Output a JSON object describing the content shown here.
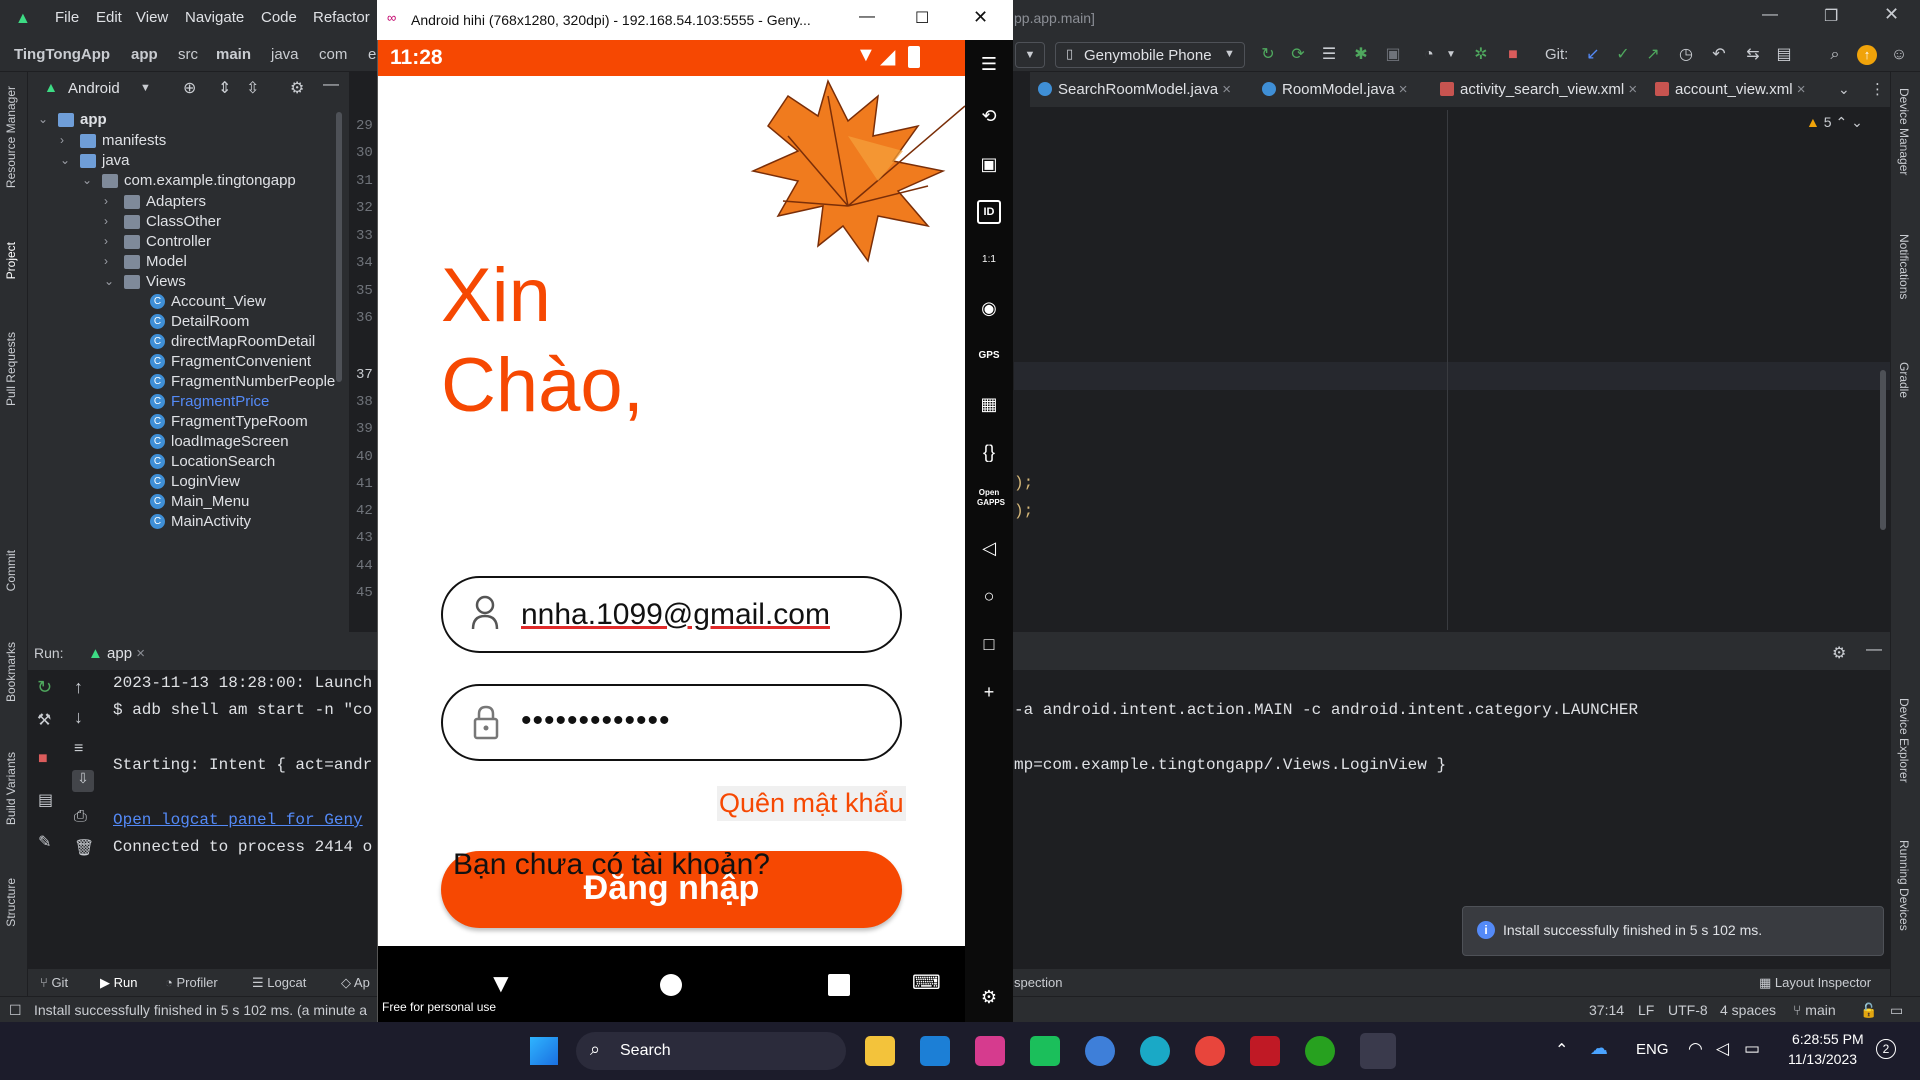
{
  "ide": {
    "menu": [
      "File",
      "Edit",
      "View",
      "Navigate",
      "Code",
      "Refactor"
    ],
    "breadcrumbs": [
      "TingTongApp",
      "app",
      "src",
      "main",
      "java",
      "com",
      "e"
    ],
    "device_selector": "Genymobile Phone",
    "git_label": "Git:",
    "title_fragment": "pp.app.main]",
    "android_view_label": "Android",
    "tree": {
      "app": "app",
      "manifests": "manifests",
      "java": "java",
      "package": "com.example.tingtongapp",
      "folders": [
        "Adapters",
        "ClassOther",
        "Controller",
        "Model",
        "Views"
      ],
      "classes": [
        "Account_View",
        "DetailRoom",
        "directMapRoomDetail",
        "FragmentConvenient",
        "FragmentNumberPeople",
        "FragmentPrice",
        "FragmentTypeRoom",
        "loadImageScreen",
        "LocationSearch",
        "LoginView",
        "Main_Menu",
        "MainActivity"
      ],
      "highlighted_class": "FragmentPrice"
    },
    "line_numbers": [
      "29",
      "30",
      "31",
      "32",
      "33",
      "34",
      "35",
      "36",
      "37",
      "38",
      "39",
      "40",
      "41",
      "42",
      "43",
      "44",
      "45"
    ],
    "editor_tabs": [
      "SearchRoomModel.java",
      "RoomModel.java",
      "activity_search_view.xml",
      "account_view.xml"
    ],
    "warning_count": "5",
    "code_fragments": [
      ");",
      ");"
    ],
    "run": {
      "label": "Run:",
      "config": "app",
      "lines_left": [
        "2023-11-13 18:28:00: Launch",
        "$ adb shell am start -n \"co",
        "",
        "Starting: Intent { act=andr",
        "",
        "Open logcat panel for Geny",
        "Connected to process 2414 o"
      ],
      "lines_right": [
        "-a android.intent.action.MAIN -c android.intent.category.LAUNCHER",
        "mp=com.example.tingtongapp/.Views.LoginView }"
      ]
    },
    "bottom_tools": [
      "Git",
      "Run",
      "Profiler",
      "Logcat",
      "Ap",
      "spection",
      "Layout Inspector"
    ],
    "status": {
      "message": "Install successfully finished in 5 s 102 ms. (a minute a",
      "position": "37:14",
      "line_sep": "LF",
      "encoding": "UTF-8",
      "indent": "4 spaces",
      "branch": "main"
    },
    "notification": "Install successfully finished in 5 s 102 ms.",
    "side_labels_left": [
      "Resource Manager",
      "Project",
      "Pull Requests",
      "Commit",
      "Bookmarks",
      "Build Variants",
      "Structure"
    ],
    "side_labels_right": [
      "Device Manager",
      "Notifications",
      "Gradle",
      "Device Explorer",
      "Running Devices"
    ]
  },
  "emulator": {
    "window_title": "Android hihi (768x1280, 320dpi) - 192.168.54.103:5555 - Geny...",
    "time": "11:28",
    "greeting_line1": "Xin",
    "greeting_line2": "Chào,",
    "email_value": "nnha.1099@gmail.com",
    "password_value": "•••••••••••••",
    "forgot_password": "Quên mật khẩu",
    "login_button": "Đăng nhập",
    "no_account": "Bạn chưa có tài khoản?",
    "watermark": "Free for personal use",
    "accent_color": "#f64802",
    "side_labels": [
      "GPS",
      "Open GAPPS",
      "ID",
      "1:1"
    ]
  },
  "taskbar": {
    "search_placeholder": "Search",
    "language": "ENG",
    "time": "6:28:55 PM",
    "date": "11/13/2023",
    "badge": "2"
  }
}
